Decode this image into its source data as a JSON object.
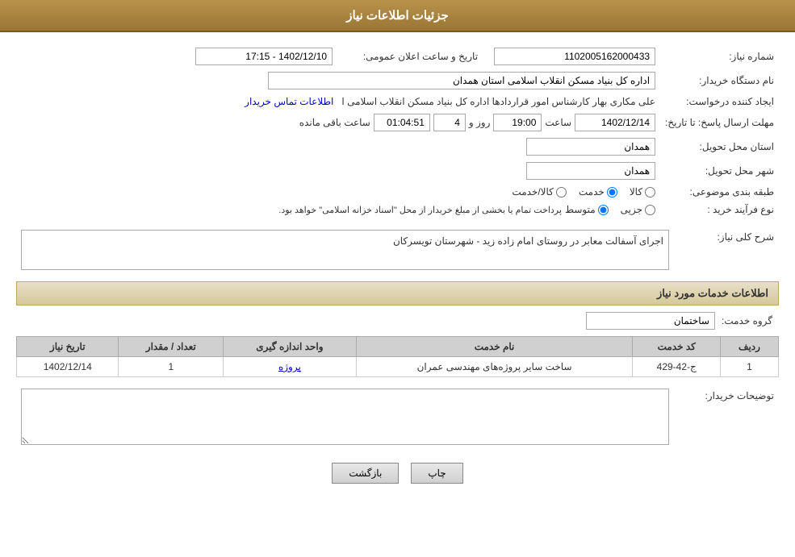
{
  "header": {
    "title": "جزئیات اطلاعات نیاز"
  },
  "fields": {
    "shomara_niaz_label": "شماره نیاز:",
    "shomara_niaz_value": "1102005162000433",
    "nam_dastgah_label": "نام دستگاه خریدار:",
    "nam_dastgah_value": "اداره کل بنیاد مسکن انقلاب اسلامی استان همدان",
    "ijad_label": "ایجاد کننده درخواست:",
    "ijad_value": "علی مکاری بهار کارشناس امور قراردادها اداره کل بنیاد مسکن انقلاب اسلامی ا",
    "ijad_link": "اطلاعات تماس خریدار",
    "mohlat_label": "مهلت ارسال پاسخ: تا تاریخ:",
    "mohlat_date": "1402/12/14",
    "mohlat_saat_label": "ساعت",
    "mohlat_saat": "19:00",
    "mohlat_rooz_label": "روز و",
    "mohlat_rooz": "4",
    "mohlat_mande_label": "ساعت باقی مانده",
    "mohlat_mande": "01:04:51",
    "ostan_label": "استان محل تحویل:",
    "ostan_value": "همدان",
    "shahr_label": "شهر محل تحویل:",
    "shahr_value": "همدان",
    "tabaqe_label": "طبقه بندی موضوعی:",
    "tabaqe_options": [
      "کالا",
      "خدمت",
      "کالا/خدمت"
    ],
    "tabaqe_selected": "خدمت",
    "noeFarayand_label": "نوع فرآیند خرید :",
    "noeFarayand_options": [
      "جزیی",
      "متوسط"
    ],
    "noeFarayand_selected": "متوسط",
    "noeFarayand_note": "پرداخت تمام یا بخشی از مبلغ خریدار از محل \"اسناد خزانه اسلامی\" خواهد بود.",
    "sharh_label": "شرح کلی نیاز:",
    "sharh_value": "اجرای آسفالت معابر در روستای امام زاده زید - شهرستان تویسرکان",
    "services_section_label": "اطلاعات خدمات مورد نیاز",
    "grohe_khadamat_label": "گروه خدمت:",
    "grohe_khadamat_value": "ساختمان",
    "tarikh_niaz_announcement": "تاریخ و ساعت اعلان عمومی:",
    "tarikh_niaz_value": "1402/12/10 - 17:15",
    "tosif_label": "توضیحات خریدار:",
    "tosif_value": ""
  },
  "services_table": {
    "columns": [
      "ردیف",
      "کد خدمت",
      "نام خدمت",
      "واحد اندازه گیری",
      "تعداد / مقدار",
      "تاریخ نیاز"
    ],
    "rows": [
      {
        "row": "1",
        "code": "ج-42-429",
        "name": "ساخت سایر پروژه‌های مهندسی عمران",
        "unit": "پروژه",
        "quantity": "1",
        "date": "1402/12/14"
      }
    ]
  },
  "buttons": {
    "print_label": "چاپ",
    "back_label": "بازگشت"
  }
}
